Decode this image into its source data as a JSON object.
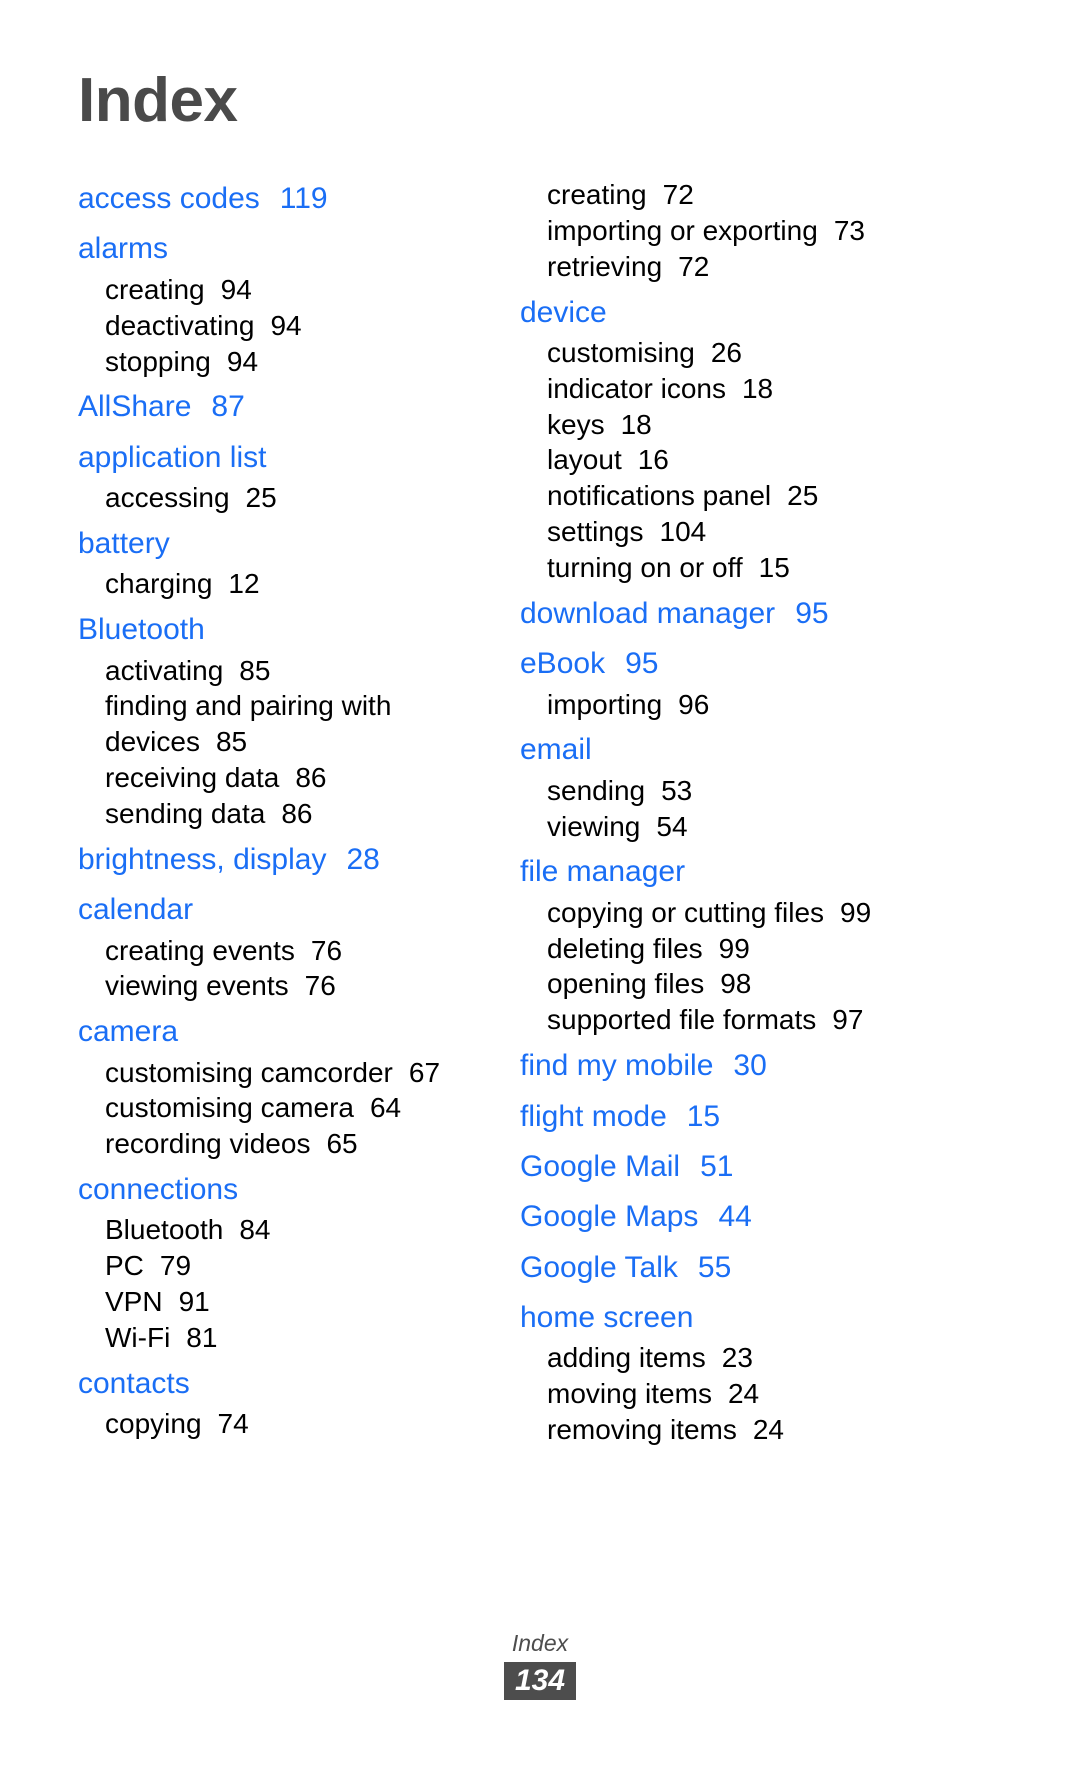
{
  "page": {
    "title": "Index",
    "heading_color": "#1a6ef5",
    "title_color": "#4a4a4a",
    "body_color": "#000000"
  },
  "columns": {
    "left": [
      {
        "heading": "access codes",
        "page": "119",
        "subs": []
      },
      {
        "heading": "alarms",
        "page": "",
        "subs": [
          {
            "label": "creating",
            "page": "94"
          },
          {
            "label": "deactivating",
            "page": "94"
          },
          {
            "label": "stopping",
            "page": "94"
          }
        ]
      },
      {
        "heading": "AllShare",
        "page": "87",
        "subs": []
      },
      {
        "heading": "application list",
        "page": "",
        "subs": [
          {
            "label": "accessing",
            "page": "25"
          }
        ]
      },
      {
        "heading": "battery",
        "page": "",
        "subs": [
          {
            "label": "charging",
            "page": "12"
          }
        ]
      },
      {
        "heading": "Bluetooth",
        "page": "",
        "subs": [
          {
            "label": "activating",
            "page": "85"
          },
          {
            "label": "finding and pairing with devices",
            "page": "85"
          },
          {
            "label": "receiving data",
            "page": "86"
          },
          {
            "label": "sending data",
            "page": "86"
          }
        ]
      },
      {
        "heading": "brightness, display",
        "page": "28",
        "subs": []
      },
      {
        "heading": "calendar",
        "page": "",
        "subs": [
          {
            "label": "creating events",
            "page": "76"
          },
          {
            "label": "viewing events",
            "page": "76"
          }
        ]
      },
      {
        "heading": "camera",
        "page": "",
        "subs": [
          {
            "label": "customising camcorder",
            "page": "67"
          },
          {
            "label": "customising camera",
            "page": "64"
          },
          {
            "label": "recording videos",
            "page": "65"
          }
        ]
      },
      {
        "heading": "connections",
        "page": "",
        "subs": [
          {
            "label": "Bluetooth",
            "page": "84"
          },
          {
            "label": "PC",
            "page": "79"
          },
          {
            "label": "VPN",
            "page": "91"
          },
          {
            "label": "Wi-Fi",
            "page": "81"
          }
        ]
      },
      {
        "heading": "contacts",
        "page": "",
        "subs": [
          {
            "label": "copying",
            "page": "74"
          }
        ]
      }
    ],
    "right": [
      {
        "heading": "",
        "page": "",
        "subs": [
          {
            "label": "creating",
            "page": "72"
          },
          {
            "label": "importing or exporting",
            "page": "73"
          },
          {
            "label": "retrieving",
            "page": "72"
          }
        ]
      },
      {
        "heading": "device",
        "page": "",
        "subs": [
          {
            "label": "customising",
            "page": "26"
          },
          {
            "label": "indicator icons",
            "page": "18"
          },
          {
            "label": "keys",
            "page": "18"
          },
          {
            "label": "layout",
            "page": "16"
          },
          {
            "label": "notifications panel",
            "page": "25"
          },
          {
            "label": "settings",
            "page": "104"
          },
          {
            "label": "turning on or off",
            "page": "15"
          }
        ]
      },
      {
        "heading": "download manager",
        "page": "95",
        "subs": []
      },
      {
        "heading": "eBook",
        "page": "95",
        "subs": [
          {
            "label": "importing",
            "page": "96"
          }
        ]
      },
      {
        "heading": "email",
        "page": "",
        "subs": [
          {
            "label": "sending",
            "page": "53"
          },
          {
            "label": "viewing",
            "page": "54"
          }
        ]
      },
      {
        "heading": "file manager",
        "page": "",
        "subs": [
          {
            "label": "copying or cutting files",
            "page": "99"
          },
          {
            "label": "deleting files",
            "page": "99"
          },
          {
            "label": "opening files",
            "page": "98"
          },
          {
            "label": "supported file formats",
            "page": "97"
          }
        ]
      },
      {
        "heading": "find my mobile",
        "page": "30",
        "subs": []
      },
      {
        "heading": "flight mode",
        "page": "15",
        "subs": []
      },
      {
        "heading": "Google Mail",
        "page": "51",
        "subs": []
      },
      {
        "heading": "Google Maps",
        "page": "44",
        "subs": []
      },
      {
        "heading": "Google Talk",
        "page": "55",
        "subs": []
      },
      {
        "heading": "home screen",
        "page": "",
        "subs": [
          {
            "label": "adding items",
            "page": "23"
          },
          {
            "label": "moving items",
            "page": "24"
          },
          {
            "label": "removing items",
            "page": "24"
          }
        ]
      }
    ]
  },
  "footer": {
    "label": "Index",
    "page_number": "134"
  }
}
